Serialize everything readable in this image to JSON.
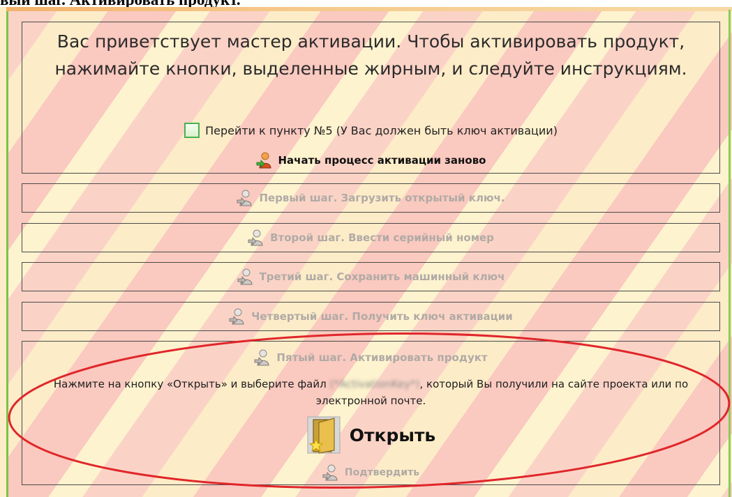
{
  "heading": "вый шаг. Активировать продукт.",
  "intro": {
    "welcome_text": "Вас приветствует мастер активации. Чтобы активировать продукт, нажимайте кнопки, выделенные жирным, и следуйте инструкциям.",
    "skip_label": "Перейти к пункту №5 (У Вас должен быть ключ активации)",
    "restart_label": "Начать процесс активации заново"
  },
  "steps": [
    {
      "label": "Первый шаг. Загрузить открытый ключ."
    },
    {
      "label": "Второй шаг. Ввести серийный номер"
    },
    {
      "label": "Третий шаг. Сохранить машинный ключ"
    },
    {
      "label": "Четвертый шаг. Получить ключ активации"
    }
  ],
  "step5": {
    "title": "Пятый шаг. Активировать продукт",
    "instruction_before": "Нажмите на кнопку «Открыть» и выберите файл ",
    "blurred_filename": "(*ActivationKey*)",
    "instruction_after": ", который Вы получили на сайте проекта или по электронной почте.",
    "open_label": "Открыть",
    "confirm_label": "Подтвердить"
  },
  "colors": {
    "highlight_ellipse": "#e0262a",
    "disabled_text": "#b0aaa5",
    "checkbox_border": "#4caf50"
  },
  "icons": {
    "user_arrow": "user-arrow-icon",
    "open_folder": "folder-star-icon"
  }
}
